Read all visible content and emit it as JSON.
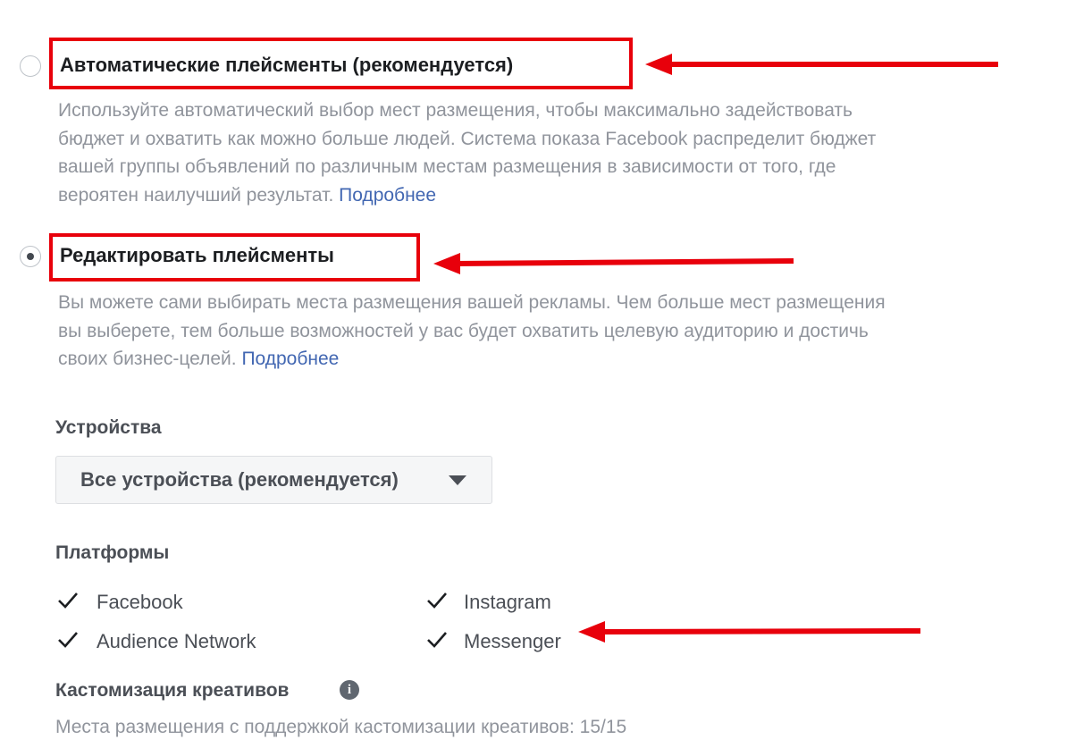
{
  "placements": {
    "automatic": {
      "title": "Автоматические плейсменты (рекомендуется)",
      "description_lines": [
        "Используйте автоматический выбор мест размещения, чтобы максимально задействовать",
        "бюджет и охватить как можно больше людей. Система показа Facebook распределит бюджет",
        "вашей группы объявлений по различным местам размещения в зависимости от того, где",
        "вероятен наилучший результат."
      ],
      "link": "Подробнее",
      "selected": false
    },
    "edit": {
      "title": "Редактировать плейсменты",
      "description_lines": [
        "Вы можете сами выбирать места размещения вашей рекламы. Чем больше мест размещения",
        "вы выберете, тем больше возможностей у вас будет охватить целевую аудиторию и достичь",
        "своих бизнес-целей."
      ],
      "link": "Подробнее",
      "selected": true
    }
  },
  "devices": {
    "label": "Устройства",
    "selected": "Все устройства (рекомендуется)"
  },
  "platforms": {
    "label": "Платформы",
    "items": [
      {
        "label": "Facebook",
        "checked": true
      },
      {
        "label": "Instagram",
        "checked": true
      },
      {
        "label": "Audience Network",
        "checked": true
      },
      {
        "label": "Messenger",
        "checked": true
      }
    ]
  },
  "customization": {
    "label": "Кастомизация креативов",
    "icon": "info-icon",
    "summary": "Места размещения с поддержкой кастомизации креативов: 15/15"
  },
  "annotation_color": "#e8000b"
}
